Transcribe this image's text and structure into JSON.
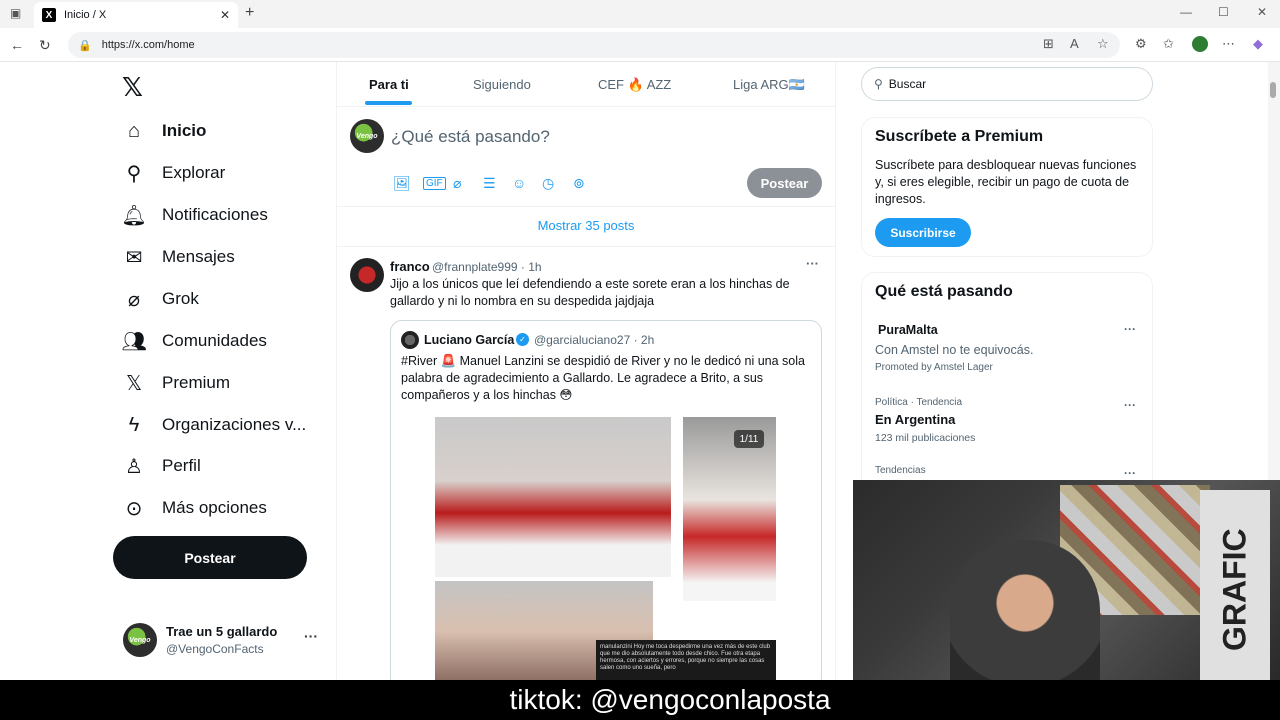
{
  "browser": {
    "tab_title": "Inicio / X",
    "url": "https://x.com/home"
  },
  "nav": {
    "items": [
      {
        "label": "Inicio",
        "icon": "home-icon"
      },
      {
        "label": "Explorar",
        "icon": "search-icon"
      },
      {
        "label": "Notificaciones",
        "icon": "bell-icon"
      },
      {
        "label": "Mensajes",
        "icon": "mail-icon"
      },
      {
        "label": "Grok",
        "icon": "grok-icon"
      },
      {
        "label": "Comunidades",
        "icon": "people-icon"
      },
      {
        "label": "Premium",
        "icon": "x-logo-icon"
      },
      {
        "label": "Organizaciones v...",
        "icon": "lightning-icon"
      },
      {
        "label": "Perfil",
        "icon": "person-icon"
      },
      {
        "label": "Más opciones",
        "icon": "more-circle-icon"
      }
    ],
    "post_button": "Postear",
    "account": {
      "name": "Trae un 5 gallardo",
      "handle": "@VengoConFacts"
    }
  },
  "feed": {
    "tabs": [
      "Para ti",
      "Siguiendo",
      "CEF 🔥 AZZ",
      "Liga ARG🇦🇷"
    ],
    "compose_placeholder": "¿Qué está pasando?",
    "compose_post_button": "Postear",
    "show_more": "Mostrar 35 posts",
    "tweet": {
      "name": "franco",
      "handle": "@frannplate999 · 1h",
      "text": "Jijo a los únicos que leí defendiendo a este sorete eran a los hinchas de gallardo y ni lo nombra en su despedida jajdjaja",
      "quote": {
        "name": "Luciano García",
        "handle": "@garcialuciano27 · 2h",
        "text": "#River 🚨 Manuel Lanzini se despidió de River y no le dedicó ni una sola palabra de agradecimiento a Gallardo. Le agradece a Brito, a sus compañeros y a los hinchas 😳",
        "media_badge": "1/11",
        "media_caption": "manulanzini Hoy me toca despedirme una vez más de este club que me dio absolutamente todo desde chico. Fue otra etapa hermosa, con aciertos y errores, porque no siempre las cosas salen como uno sueña, pero"
      }
    }
  },
  "sidebar": {
    "search_placeholder": "Buscar",
    "premium": {
      "title": "Suscríbete a Premium",
      "description": "Suscríbete para desbloquear nuevas funciones y, si eres elegible, recibir un pago de cuota de ingresos.",
      "button": "Suscribirse"
    },
    "trends": {
      "title": "Qué está pasando",
      "ad": {
        "name": "PuraMalta",
        "text": "Con Amstel no te equivocás.",
        "promoted": "Promoted by Amstel Lager"
      },
      "items": [
        {
          "category": "Política · Tendencia",
          "name": "En Argentina",
          "count": "123 mil publicaciones"
        },
        {
          "category": "Tendencias"
        }
      ]
    }
  },
  "overlay": {
    "banner": "tiktok: @vengoconlaposta",
    "sign_text": "GRAFIC"
  },
  "colors": {
    "accent": "#1d9bf0",
    "text": "#0f1419",
    "muted": "#536471"
  }
}
